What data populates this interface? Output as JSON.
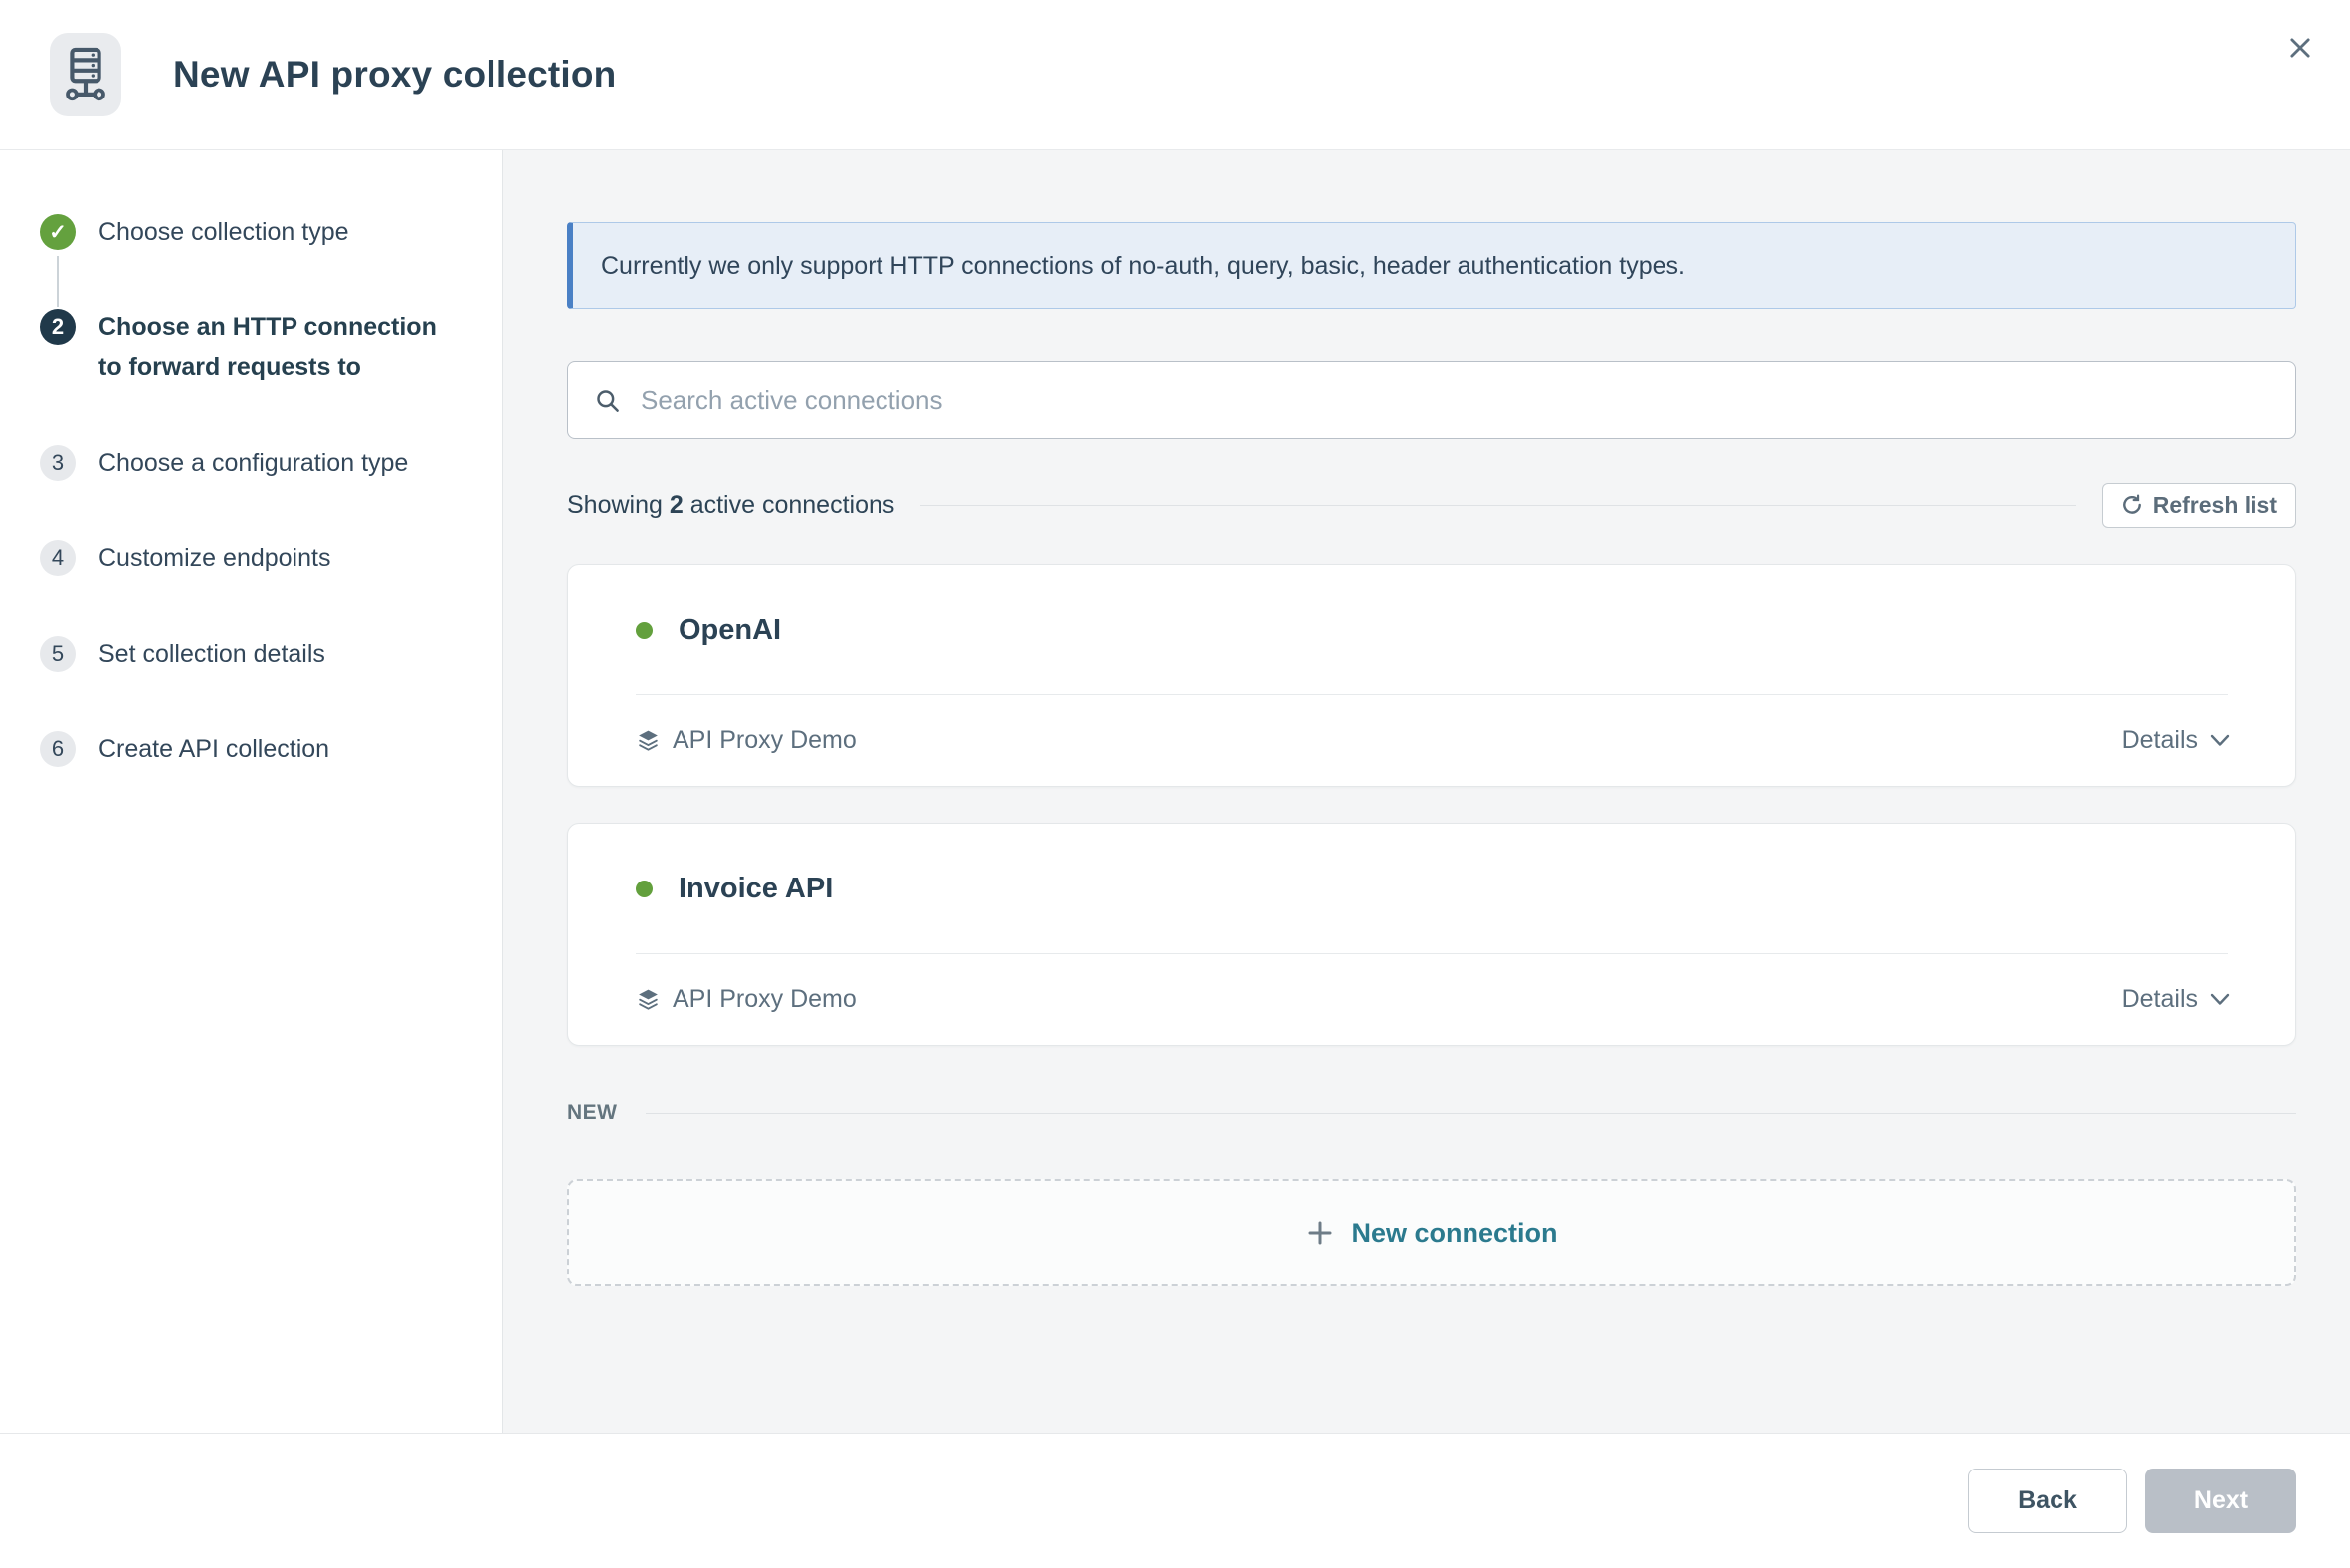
{
  "header": {
    "title": "New API proxy collection",
    "icon": "proxy-server-icon",
    "close_icon": "x-icon"
  },
  "stepper": {
    "steps": [
      {
        "glyph": "✓",
        "label": "Choose collection type",
        "state": "completed"
      },
      {
        "glyph": "2",
        "label": "Choose an HTTP connection to forward requests to",
        "state": "active"
      },
      {
        "glyph": "3",
        "label": "Choose a configuration type",
        "state": "upcoming"
      },
      {
        "glyph": "4",
        "label": "Customize endpoints",
        "state": "upcoming"
      },
      {
        "glyph": "5",
        "label": "Set collection details",
        "state": "upcoming"
      },
      {
        "glyph": "6",
        "label": "Create API collection",
        "state": "upcoming"
      }
    ]
  },
  "main": {
    "banner": {
      "text": "Currently we only support HTTP connections of no-auth, query, basic, header authentication types."
    },
    "search": {
      "placeholder": "Search active connections",
      "value": "",
      "icon": "magnifier-icon"
    },
    "results": {
      "prefix": "Showing ",
      "count": "2",
      "suffix": " active connections",
      "refresh_label": "Refresh list",
      "refresh_icon": "refresh-icon"
    },
    "connections": [
      {
        "name": "OpenAI",
        "status": "active",
        "status_color": "#63a03d",
        "app": "API Proxy Demo",
        "app_icon": "layers-icon",
        "details_label": "Details"
      },
      {
        "name": "Invoice API",
        "status": "active",
        "status_color": "#63a03d",
        "app": "API Proxy Demo",
        "app_icon": "layers-icon",
        "details_label": "Details"
      }
    ],
    "new_section": {
      "label": "NEW",
      "button_label": "New connection",
      "button_icon": "plus-icon"
    }
  },
  "footer": {
    "back_label": "Back",
    "next_label": "Next",
    "next_enabled": false
  },
  "colors": {
    "accent_blue": "#4a80c5",
    "banner_bg": "#e7eef7",
    "green_status": "#63a03d",
    "step_active": "#20394a",
    "teal_link": "#2b7a8e",
    "disabled_gray": "#b9bfc7",
    "main_bg": "#f4f5f6",
    "text_primary": "#2b4254",
    "text_secondary": "#5d6f7e"
  }
}
